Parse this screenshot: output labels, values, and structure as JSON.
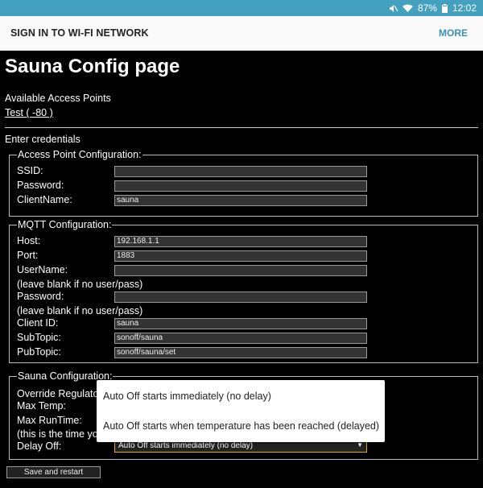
{
  "statusbar": {
    "battery": "87%",
    "time": "12:02"
  },
  "appbar": {
    "title": "SIGN IN TO WI-FI NETWORK",
    "more": "MORE"
  },
  "page": {
    "title": "Sauna Config page",
    "available_label": "Available Access Points",
    "ap_link": "Test  ( -80 )",
    "enter_credentials": "Enter credentials"
  },
  "ap_config": {
    "legend": "Access Point Configuration:",
    "ssid_label": "SSID:",
    "ssid_value": "",
    "password_label": "Password:",
    "password_value": "",
    "clientname_label": "ClientName:",
    "clientname_value": "sauna"
  },
  "mqtt": {
    "legend": "MQTT Configuration:",
    "host_label": "Host:",
    "host_value": "192.168.1.1",
    "port_label": "Port:",
    "port_value": "1883",
    "username_label": "UserName:",
    "username_value": "",
    "username_note": "(leave blank if no user/pass)",
    "password_label": "Password:",
    "password_value": "",
    "password_note": "(leave blank if no user/pass)",
    "clientid_label": "Client ID:",
    "clientid_value": "sauna",
    "subtopic_label": "SubTopic:",
    "subtopic_value": "sonoff/sauna",
    "pubtopic_label": "PubTopic:",
    "pubtopic_value": "sonoff/sauna/set"
  },
  "sauna": {
    "legend": "Sauna Configuration:",
    "override_label": "Override Regulato",
    "maxtemp_label": "Max Temp:",
    "maxruntime_label": "Max RunTime:",
    "time_note": "(this is the time yo",
    "delayoff_label": "Delay Off:",
    "delayoff_value": "Auto Off starts immediately (no delay)"
  },
  "dropdown": {
    "options": [
      "Auto Off starts immediately (no delay)",
      "Auto Off starts when temperature has been reached (delayed)"
    ]
  },
  "save_button": "Save and restart"
}
